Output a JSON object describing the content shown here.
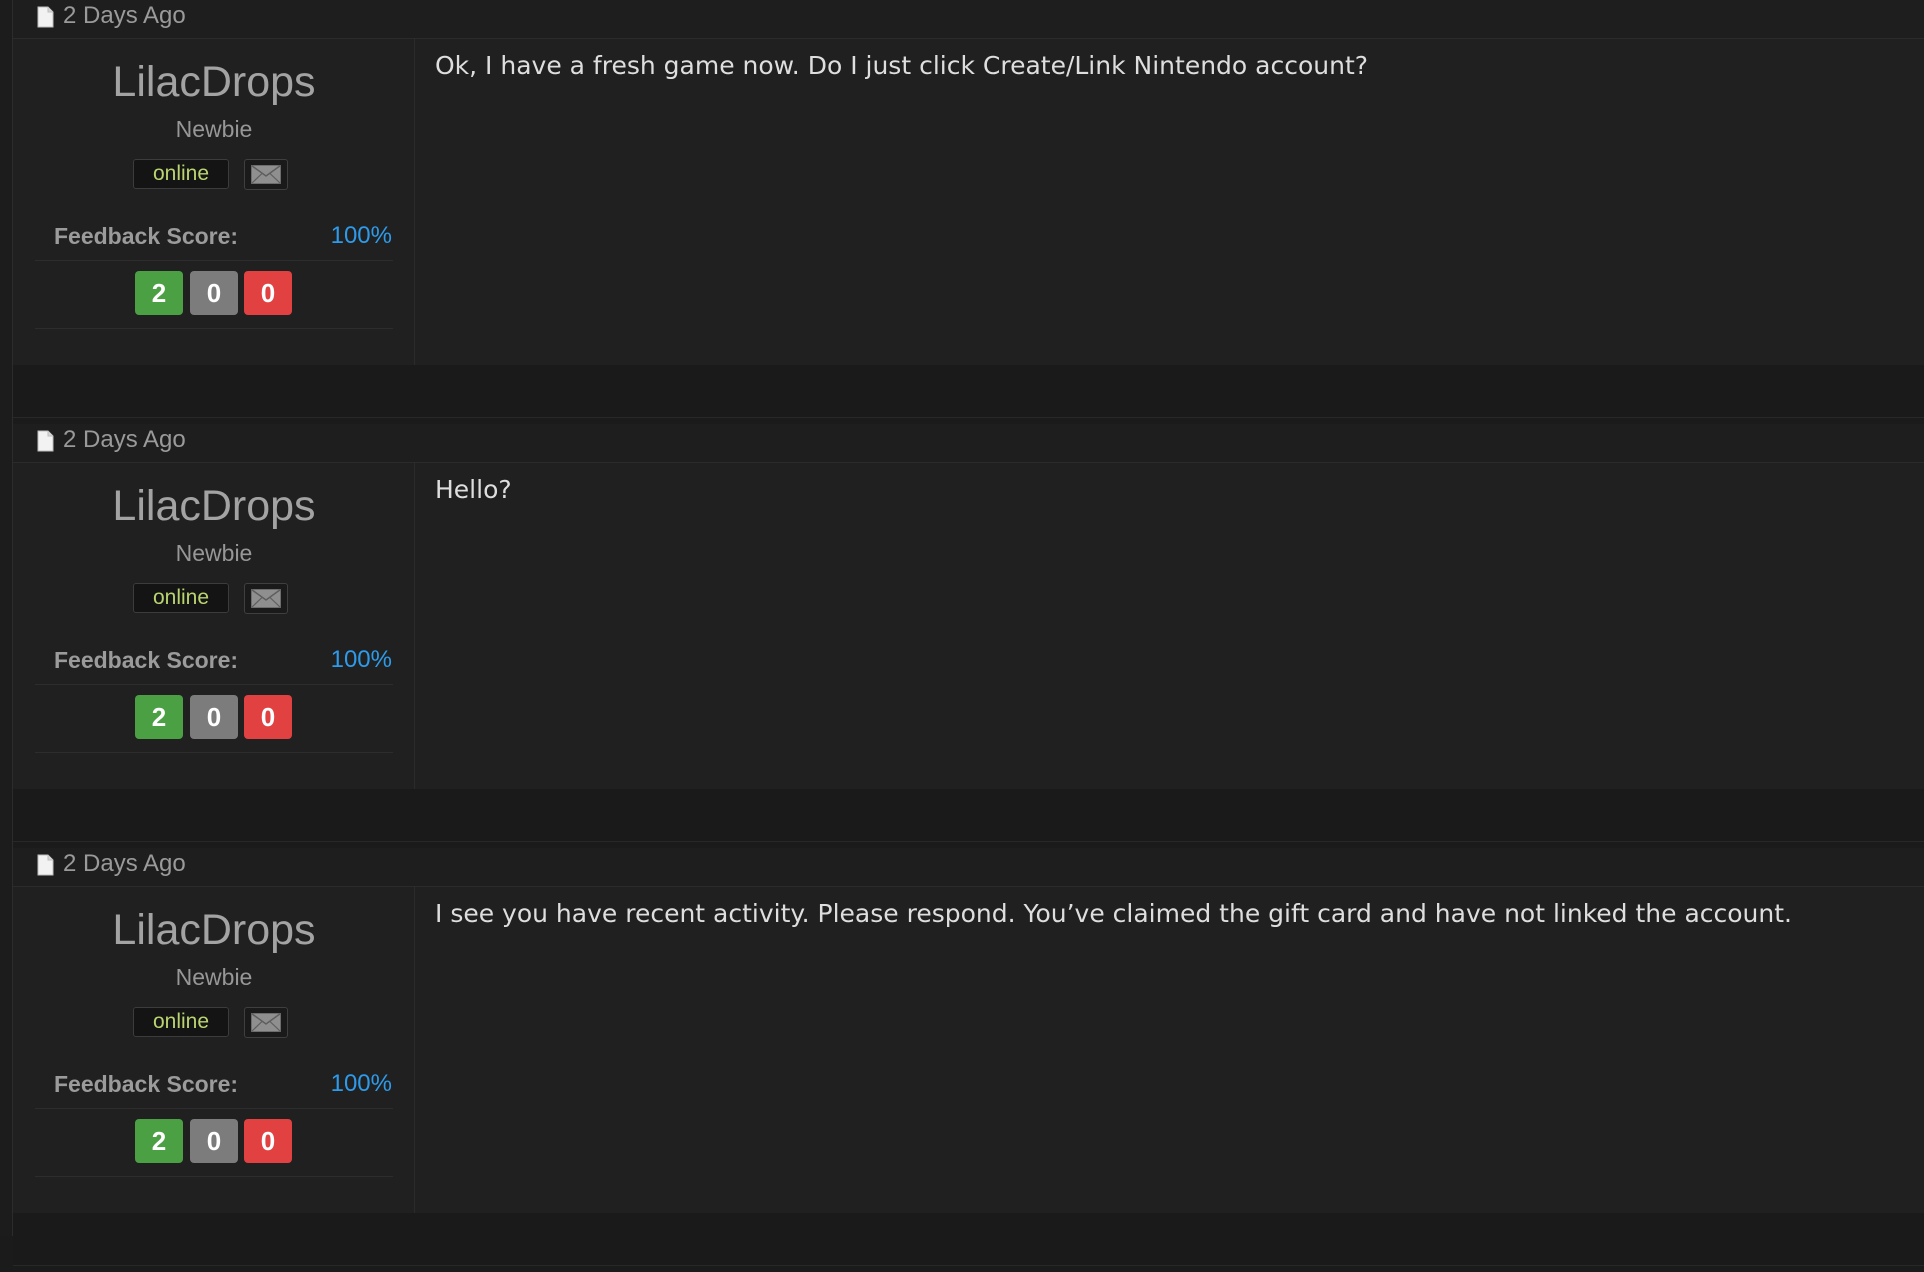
{
  "posts": [
    {
      "date": "2 Days Ago",
      "username": "LilacDrops",
      "user_title": "Newbie",
      "status": "online",
      "feedback_label": "Feedback Score:",
      "feedback_score": "100%",
      "feedback": {
        "positive": "2",
        "neutral": "0",
        "negative": "0"
      },
      "message": "Ok, I have a fresh game now. Do I just click Create/Link Nintendo account?"
    },
    {
      "date": "2 Days Ago",
      "username": "LilacDrops",
      "user_title": "Newbie",
      "status": "online",
      "feedback_label": "Feedback Score:",
      "feedback_score": "100%",
      "feedback": {
        "positive": "2",
        "neutral": "0",
        "negative": "0"
      },
      "message": "Hello?"
    },
    {
      "date": "2 Days Ago",
      "username": "LilacDrops",
      "user_title": "Newbie",
      "status": "online",
      "feedback_label": "Feedback Score:",
      "feedback_score": "100%",
      "feedback": {
        "positive": "2",
        "neutral": "0",
        "negative": "0"
      },
      "message": "I see you have recent activity. Please respond. You’ve claimed the gift card and have not linked the account."
    }
  ],
  "icons": {
    "post_icon": "document-icon",
    "pm_icon": "envelope-icon"
  },
  "colors": {
    "feedback_positive": "#4aa043",
    "feedback_neutral": "#7c7c7c",
    "feedback_negative": "#e14141",
    "score_link": "#2e9bea",
    "online_text": "#b9d470"
  }
}
